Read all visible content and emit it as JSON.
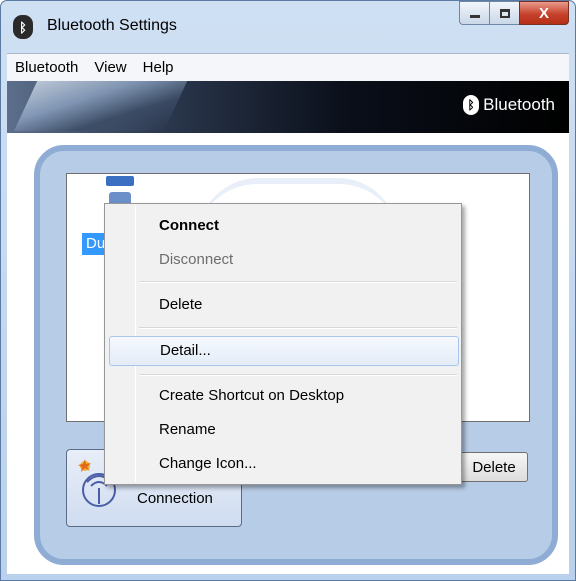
{
  "window": {
    "title": "Bluetooth Settings",
    "icon": "bluetooth-icon",
    "controls": {
      "minimize": "minimize-icon",
      "maximize": "maximize-icon",
      "close": "X"
    }
  },
  "menubar": {
    "items": [
      "Bluetooth",
      "View",
      "Help"
    ]
  },
  "banner": {
    "logo_text": "Bluetooth",
    "logo_icon": "bluetooth-icon"
  },
  "device_list": {
    "items": [
      {
        "label": "Du",
        "icon": "device-icon",
        "selected": true
      }
    ]
  },
  "buttons": {
    "connection_label": "Connection",
    "delete_label": "Delete"
  },
  "context_menu": {
    "items": [
      {
        "label": "Connect",
        "style": "bold"
      },
      {
        "label": "Disconnect",
        "style": "disabled"
      },
      {
        "label": "Delete",
        "style": "normal"
      },
      {
        "label": "Detail...",
        "style": "hover"
      },
      {
        "label": "Create Shortcut on Desktop",
        "style": "normal"
      },
      {
        "label": "Rename",
        "style": "normal"
      },
      {
        "label": "Change Icon...",
        "style": "normal"
      }
    ]
  },
  "colors": {
    "selection": "#3399ff",
    "panel_border": "#8eacd4",
    "panel_fill": "#b7cce6",
    "close_button": "#c7422c"
  }
}
